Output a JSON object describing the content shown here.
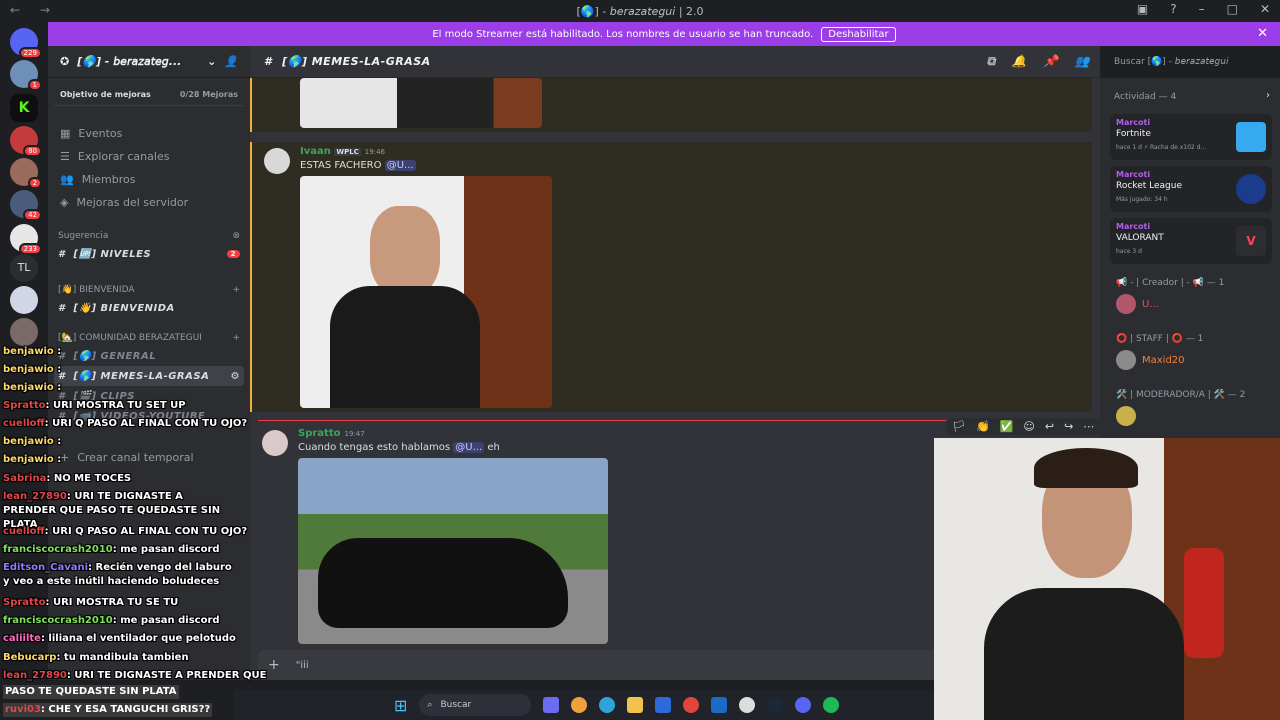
{
  "window": {
    "title": "[🌎] - 𝘣𝘦𝘳𝘢𝘻𝘢𝘵𝘦𝘨𝘶𝘪 | 2.0"
  },
  "banner": {
    "text": "El modo Streamer está habilitado. Los nombres de usuario se han truncado.",
    "button": "Deshabilitar"
  },
  "guild_badges": [
    "229",
    "1",
    "80",
    "2",
    "42",
    "233"
  ],
  "guild_tl": "TL",
  "server": {
    "name": "[🌎] - 𝘣𝘦𝘳𝘢𝘻𝘢𝘵𝘦𝘨...",
    "boost_label": "Objetivo de mejoras",
    "boost_value": "0/28 Mejoras",
    "menu": [
      "Eventos",
      "Explorar canales",
      "Miembros",
      "Mejoras del servidor"
    ],
    "suggestion_label": "Sugerencia",
    "niveles": "[🆙] NIVELES",
    "niveles_badge": "2",
    "cat_bienvenida": "[👋] BIENVENIDA",
    "chan_bienvenida": "[👋] BIENVENIDA",
    "cat_comunidad": "[🏡] COMUNIDAD BERAZATEGUI",
    "chan_general": "[🌎] GENERAL",
    "chan_memes": "[🌎] MEMES-LA-GRASA",
    "chan_clips": "[🎬] CLIPS",
    "chan_videos": "[📹] VIDEOS-YOUTUBE",
    "chan_temp": "Crear canal temporal"
  },
  "chat": {
    "channel": "[🌎] MEMES-LA-GRASA",
    "search_placeholder": "Buscar [🌎] - 𝘣𝘦𝘳𝘢𝘻𝘢𝘵𝘦𝘨𝘶𝘪",
    "messages": [
      {
        "author": "Ivaan",
        "tag": "WPLC",
        "time": "19:46",
        "text": "ESTAS FACHERO",
        "mention": "@U..."
      },
      {
        "author": "Spratto",
        "time": "19:47",
        "text": "Cuando tengas esto hablamos",
        "mention": "@U...",
        "text_after": "eh"
      }
    ],
    "composer_hint": "\"iii"
  },
  "activity": {
    "header": "Actividad — 4",
    "cards": [
      {
        "user": "Marcoti",
        "game": "Fortnite",
        "sub": "hace 1 d  ⚡ Racha de x102 d...",
        "color": "#37a9f0"
      },
      {
        "user": "Marcoti",
        "game": "Rocket League",
        "sub": "Más jugado: 34 h",
        "color": "#1b3b8c"
      },
      {
        "user": "Marcoti",
        "game": "VALORANT",
        "sub": "hace 3 d",
        "color": "#2b2d31"
      }
    ],
    "roles": [
      {
        "name": "📢 - | Creador | - 📢 — 1",
        "member": "U...",
        "color": "#e84a5f"
      },
      {
        "name": "⭕ | STAFF | ⭕ — 1",
        "member": "Maxid20",
        "color": "#f0803c"
      },
      {
        "name": "🛠️ | MODERADOR/A | 🛠️ — 2",
        "member": "",
        "color": "#dbdee1"
      }
    ]
  },
  "twitch_chat": [
    {
      "user": "benjawio",
      "text": ":",
      "color": "#ffd966"
    },
    {
      "user": "benjawio",
      "text": ":",
      "color": "#ffd966"
    },
    {
      "user": "benjawio",
      "text": ":",
      "color": "#ffd966"
    },
    {
      "user": "Spratto",
      "text": ": URI MOSTRA TU SET UP",
      "color": "#e0464c"
    },
    {
      "user": "cuelloff",
      "text": ": URI Q PASO AL FINAL CON TU OJO?",
      "color": "#e0464c"
    },
    {
      "user": "benjawio",
      "text": ":",
      "color": "#ffd966"
    },
    {
      "user": "benjawio",
      "text": ":",
      "color": "#ffd966"
    },
    {
      "user": "Sabrina",
      "text": ": NO ME TOCES",
      "color": "#e0464c"
    },
    {
      "user": "lean_27890",
      "text": ": URI TE DIGNASTE A PRENDER QUE PASO TE QUEDASTE SIN PLATA",
      "color": "#e0464c"
    },
    {
      "user": "cuelloff",
      "text": ": URI Q PASO AL FINAL CON TU OJO?",
      "color": "#e0464c"
    },
    {
      "user": "franciscocrash2010",
      "text": ": me pasan discord",
      "color": "#7fe35a"
    },
    {
      "user": "Editson_Cavani",
      "text": ": Recién vengo del laburo y veo a este inútil haciendo boludeces",
      "color": "#8f7cff"
    },
    {
      "user": "Spratto",
      "text": ": URI MOSTRA TU SE TU",
      "color": "#e0464c"
    },
    {
      "user": "franciscocrash2010",
      "text": ": me pasan discord",
      "color": "#7fe35a"
    },
    {
      "user": "caliilte",
      "text": ": liliana el ventilador que pelotudo",
      "color": "#ff69c0"
    },
    {
      "user": "Bebucarp",
      "text": ": tu mandibula tambien",
      "color": "#ffd966"
    },
    {
      "user": "lean_27890",
      "text": ": URI TE DIGNASTE A PRENDER QUE",
      "color": "#e0464c"
    },
    {
      "user": "",
      "text": "PASO TE QUEDASTE SIN PLATA",
      "color": "#e0464c"
    },
    {
      "user": "ruvi03",
      "text": ": CHE Y ESA TANGUCHI GRIS??",
      "color": "#e0464c"
    }
  ],
  "taskbar": {
    "search": "Buscar"
  }
}
